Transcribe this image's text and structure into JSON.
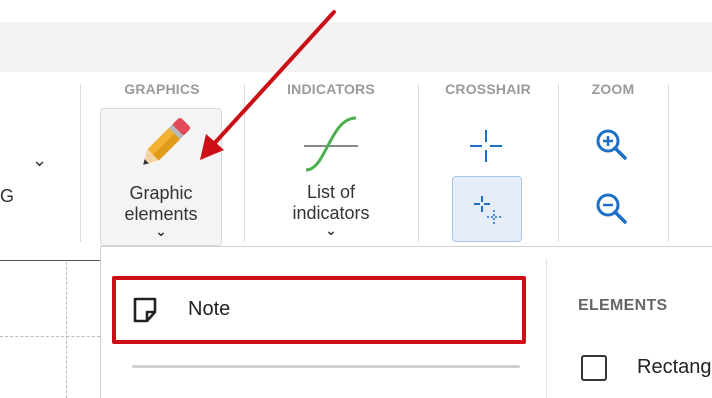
{
  "toolbar": {
    "left_fragment": "G",
    "groups": {
      "graphics": "GRAPHICS",
      "indicators": "INDICATORS",
      "crosshair": "CROSSHAIR",
      "zoom": "ZOOM"
    },
    "graphic_elements_button": {
      "line1": "Graphic",
      "line2": "elements",
      "icon": "pencil-icon"
    },
    "indicators_button": {
      "line1": "List of",
      "line2": "indicators",
      "icon": "indicator-curve-icon"
    },
    "crosshair_icons": [
      "crosshair-icon",
      "crosshair-magnet-icon"
    ],
    "zoom_icons": [
      "zoom-in-icon",
      "zoom-out-icon"
    ]
  },
  "dropdown": {
    "note_label": "Note",
    "note_icon": "note-icon",
    "elements_heading": "ELEMENTS",
    "rectangle_label": "Rectangle"
  },
  "colors": {
    "highlight_red": "#cc0e16",
    "accent_blue": "#1e6fc8",
    "indicator_green": "#4caf50"
  }
}
